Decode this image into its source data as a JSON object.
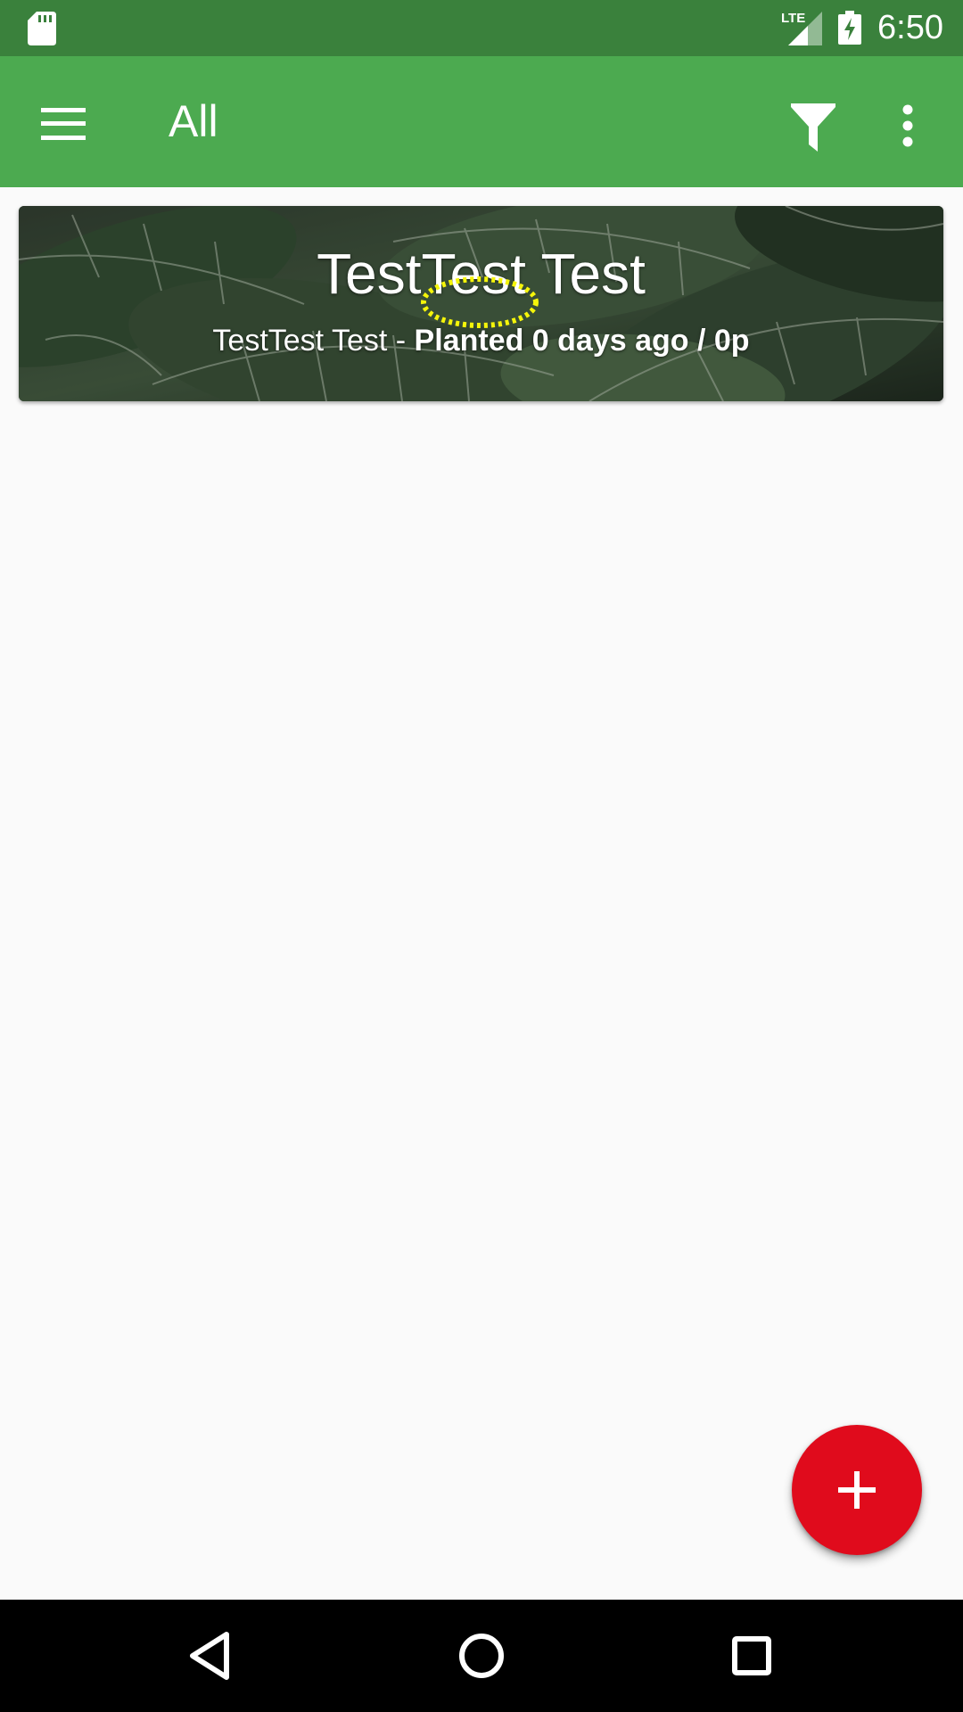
{
  "status_bar": {
    "time": "6:50",
    "network_label": "LTE",
    "icons": [
      "sd-card-icon",
      "lte-signal-icon",
      "battery-charging-icon"
    ]
  },
  "app_bar": {
    "title": "All",
    "icons": [
      "menu-icon",
      "filter-icon",
      "more-vert-icon"
    ]
  },
  "plants": [
    {
      "name": "TestTest Test",
      "species": "TestTest Test",
      "separator": " - ",
      "status": "Planted 0 days ago / 0p"
    }
  ],
  "fab": {
    "icon": "plus-icon"
  },
  "nav_bar": {
    "icons": [
      "back-icon",
      "home-icon",
      "recents-icon"
    ]
  },
  "colors": {
    "status_bar": "#3a813c",
    "app_bar": "#4caa50",
    "background": "#fafafa",
    "fab": "#e00b1c",
    "nav_bar": "#000000",
    "tap_marker": "#f5f50a"
  }
}
